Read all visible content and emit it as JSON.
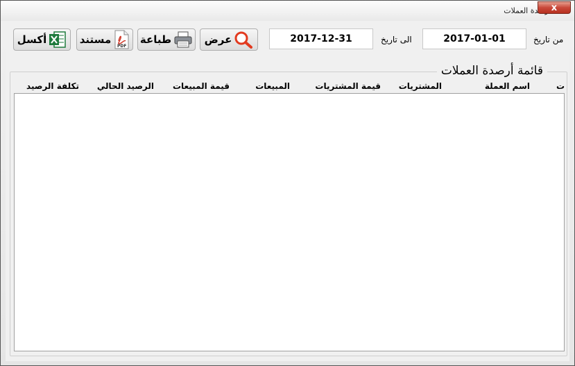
{
  "window": {
    "title": "أرصدة العملات",
    "close_glyph": "x"
  },
  "toolbar": {
    "view_label": "عرض",
    "print_label": "طباعة",
    "document_label": "مستند",
    "excel_label": "أكسل",
    "pdf_badge": "PDF"
  },
  "filters": {
    "from_label": "من تاريخ",
    "from_value": "2017-01-01",
    "to_label": "الى تاريخ",
    "to_value": "2017-12-31"
  },
  "list": {
    "title": "قائمة أرصدة العملات",
    "columns": [
      "ت",
      "اسم العملة",
      "المشتريات",
      "قيمة المشتريات",
      "المبيعات",
      "قيمة المبيعات",
      "الرصيد الحالي",
      "تكلفة الرصيد"
    ],
    "rows": []
  },
  "colors": {
    "search_icon": "#e23a1f",
    "excel_icon": "#1e7a3c",
    "pdf_icon": "#d23b2b"
  }
}
